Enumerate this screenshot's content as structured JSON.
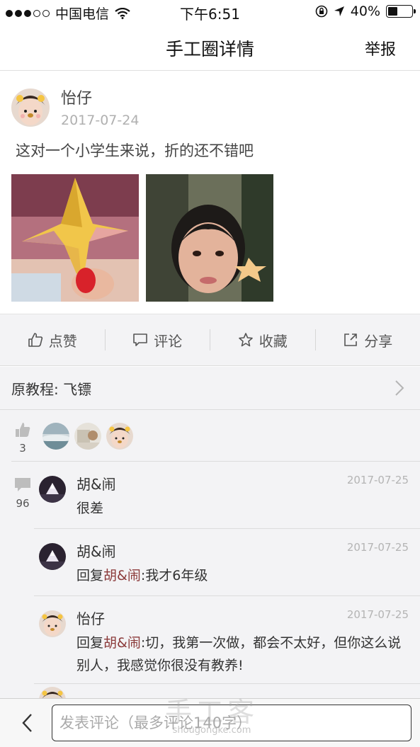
{
  "status_bar": {
    "carrier": "中国电信",
    "time": "下午6:51",
    "battery": "40%",
    "battery_level": 0.4
  },
  "nav": {
    "title": "手工圈详情",
    "report_label": "举报"
  },
  "post": {
    "author": "怡仔",
    "date": "2017-07-24",
    "text": "这对一个小学生来说，折的还不错吧"
  },
  "actions": {
    "like_label": "点赞",
    "comment_label": "评论",
    "favorite_label": "收藏",
    "share_label": "分享"
  },
  "tutorial": {
    "label": "原教程: 飞镖"
  },
  "likes": {
    "count": "3"
  },
  "comments_section": {
    "count": "96",
    "items": [
      {
        "name": "胡&闹",
        "date": "2017-07-25",
        "text": "很差"
      },
      {
        "name": "胡&闹",
        "date": "2017-07-25",
        "reply_prefix": "回复",
        "reply_to": "胡&闹",
        "text": ":我才6年级"
      },
      {
        "name": "怡仔",
        "date": "2017-07-25",
        "reply_prefix": "回复",
        "reply_to": "胡&闹",
        "text": ":切，我第一次做，都会不太好，但你这么说别人，我感觉你很没有教养!"
      }
    ]
  },
  "bottom": {
    "input_placeholder": "发表评论（最多评论140字）"
  },
  "watermark": {
    "big": "手工客",
    "small": "shougongke.com"
  },
  "colors": {
    "reply_name": "#8b3a3a",
    "content_bg": "#f3f3f5"
  }
}
